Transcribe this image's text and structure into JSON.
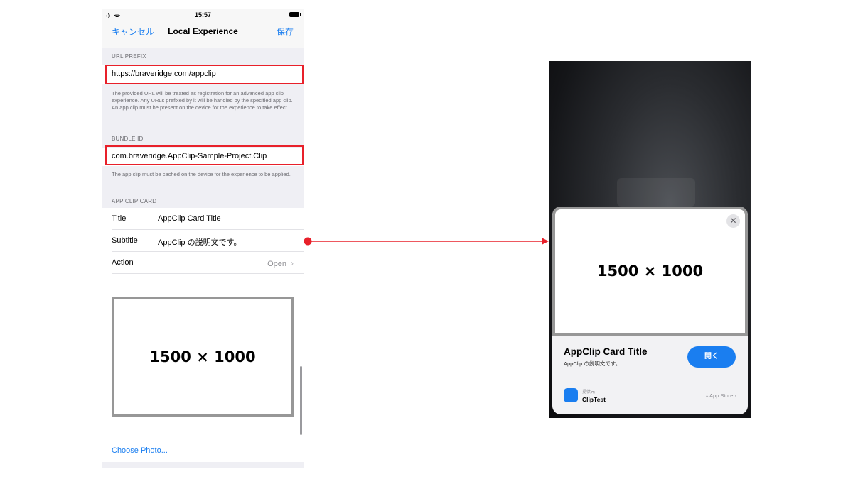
{
  "left_screen": {
    "status": {
      "time": "15:57",
      "left_icons": "✈ ᯤ"
    },
    "nav": {
      "cancel": "キャンセル",
      "title": "Local Experience",
      "save": "保存"
    },
    "url_prefix": {
      "header": "URL PREFIX",
      "value": "https://braveridge.com/appclip",
      "note": "The provided URL will be treated as registration for an advanced app clip experience. Any URLs prefixed by it will be handled by the specified app clip. An app clip must be present on the device for the experience to take effect."
    },
    "bundle_id": {
      "header": "BUNDLE ID",
      "value": "com.braveridge.AppClip-Sample-Project.Clip",
      "note": "The app clip must be cached on the device for the experience to be applied."
    },
    "app_clip_card": {
      "header": "APP CLIP CARD",
      "rows": [
        {
          "key": "Title",
          "value": "AppClip Card Title"
        },
        {
          "key": "Subtitle",
          "value": "AppClip の説明文です。"
        },
        {
          "key": "Action",
          "value": "Open"
        }
      ]
    },
    "photo": {
      "placeholder": "1500 × 1000",
      "choose": "Choose Photo..."
    }
  },
  "right_screen": {
    "card": {
      "image_placeholder": "1500 × 1000",
      "close_icon": "close-icon",
      "title": "AppClip Card Title",
      "subtitle": "AppClip の説明文です。",
      "open_button": "開く",
      "provider_label": "提供元",
      "provider_name": "ClipTest",
      "appstore": "App Store"
    }
  },
  "colors": {
    "accent": "#1a7ef0",
    "highlight": "#e8202a",
    "grouped_bg": "#efeff4"
  }
}
